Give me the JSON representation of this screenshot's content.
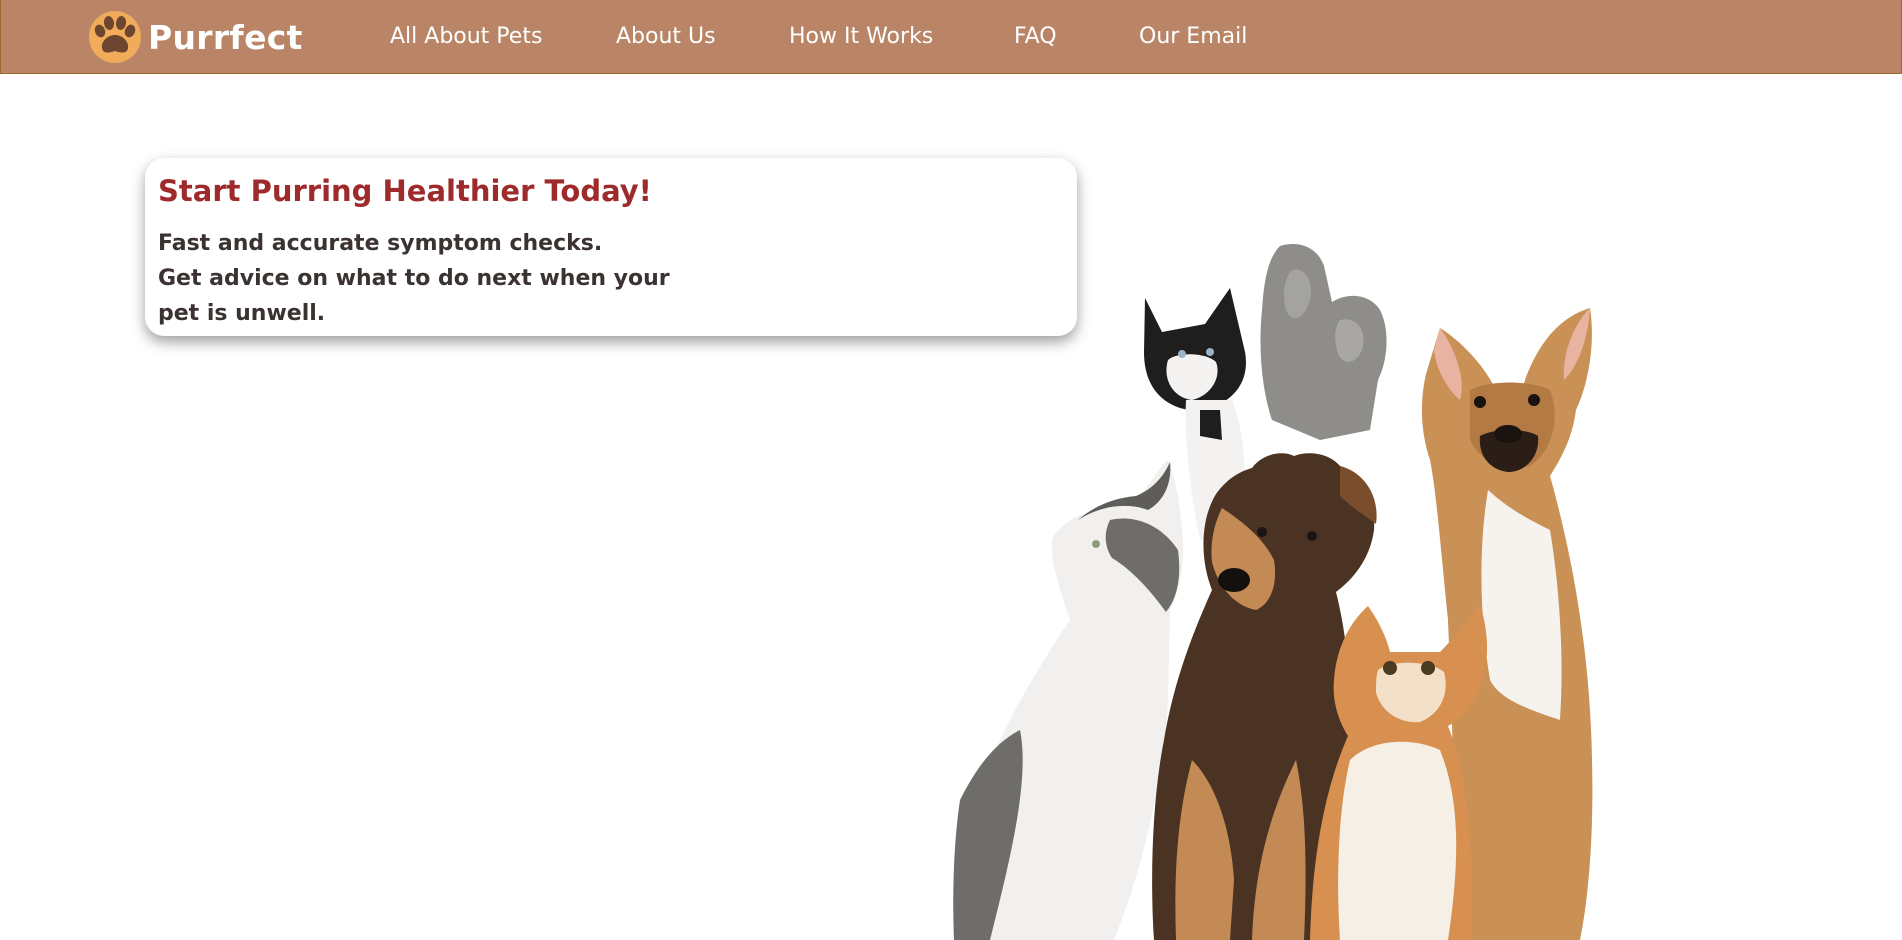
{
  "header": {
    "brand_name": "Purrfect",
    "logo_icon": "paw-print-icon",
    "nav_links": [
      {
        "label": "All About Pets"
      },
      {
        "label": "About Us"
      },
      {
        "label": "How It Works"
      },
      {
        "label": "FAQ"
      },
      {
        "label": "Our Email"
      }
    ]
  },
  "hero": {
    "title": "Start Purring Healthier Today!",
    "description_lines": [
      "Fast and accurate symptom checks.",
      "Get advice on what to do next when your",
      "pet is unwell."
    ]
  },
  "colors": {
    "nav_background": "#b98566",
    "nav_text": "#ffffff",
    "logo_paw": "#f0ac5a",
    "hero_title": "#9e2a2b",
    "hero_text": "#3b3331",
    "page_background": "#ffffff"
  }
}
